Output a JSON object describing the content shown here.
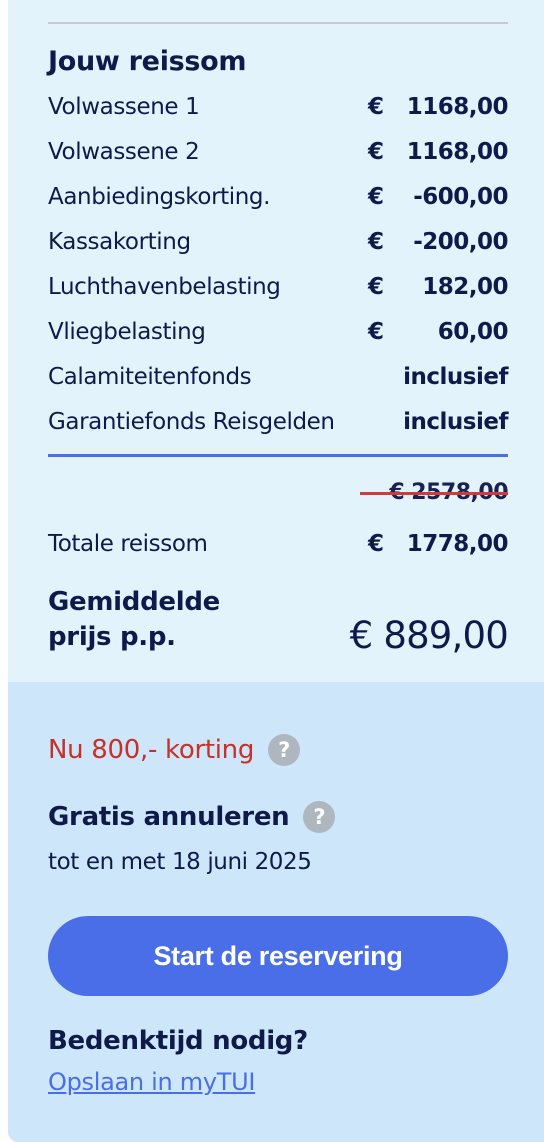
{
  "summary": {
    "heading": "Jouw reissom",
    "currency_symbol": "€",
    "lines": [
      {
        "label": "Volwassene 1",
        "currency": "€",
        "amount": "1168,00"
      },
      {
        "label": "Volwassene 2",
        "currency": "€",
        "amount": "1168,00"
      },
      {
        "label": "Aanbiedingskorting.",
        "currency": "€",
        "amount": "-600,00"
      },
      {
        "label": "Kassakorting",
        "currency": "€",
        "amount": "-200,00"
      },
      {
        "label": "Luchthavenbelasting",
        "currency": "€",
        "amount": "182,00"
      },
      {
        "label": "Vliegbelasting",
        "currency": "€",
        "amount": "60,00"
      },
      {
        "label": "Calamiteitenfonds",
        "currency": "",
        "amount": "inclusief"
      },
      {
        "label": "Garantiefonds Reisgelden",
        "currency": "",
        "amount": "inclusief"
      }
    ],
    "old_total": "€ 2578,00",
    "total_label": "Totale reissom",
    "total_currency": "€",
    "total_amount": "1778,00",
    "avg_label": "Gemiddelde prijs p.p.",
    "avg_value": "€ 889,00"
  },
  "offer": {
    "discount_text": "Nu 800,- korting",
    "discount_help": "?",
    "cancel_title": "Gratis annuleren",
    "cancel_help": "?",
    "cancel_until": "tot en met 18 juni 2025",
    "cta_label": "Start de reservering",
    "think_title": "Bedenktijd nodig?",
    "save_link": "Opslaan in myTUI"
  },
  "colors": {
    "accent_blue": "#4a6ee8",
    "discount_red": "#c8302a",
    "navy_text": "#0f1a4a",
    "panel_light": "#e3f3fc",
    "panel_blue": "#cde6fa"
  },
  "icons": {
    "help": "question-mark-circle-icon"
  }
}
